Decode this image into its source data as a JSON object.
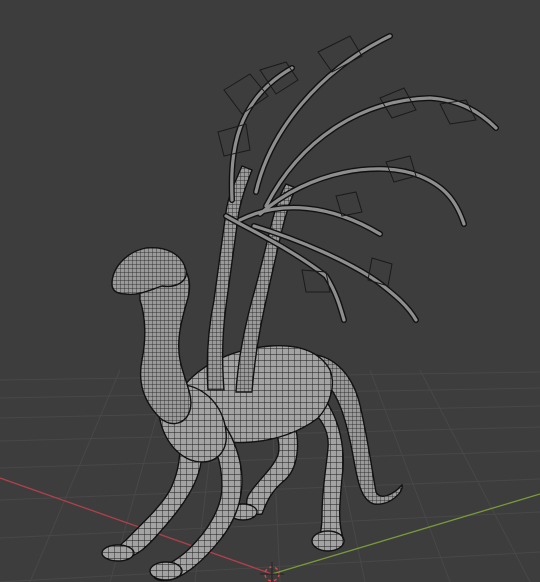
{
  "viewport": {
    "background": "#3d3d3d",
    "grid_color": "#4a4a4a",
    "x_axis_color": "#b0404a",
    "y_axis_color": "#7a9a3a",
    "mesh_fill": "#9c9c9c",
    "wire_color": "#111111"
  },
  "scene": {
    "object": "creature-mesh",
    "display_mode": "wireframe-overlay",
    "origin_marker": "3d-cursor"
  }
}
